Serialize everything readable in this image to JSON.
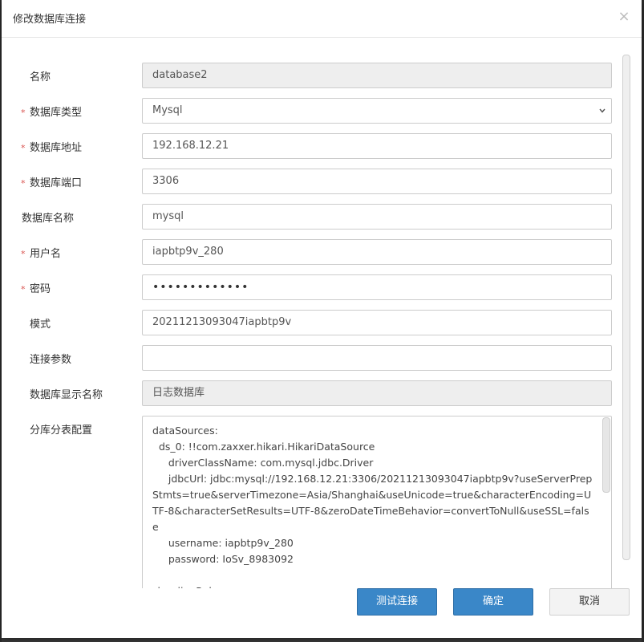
{
  "dialog": {
    "title": "修改数据库连接",
    "close_symbol": "×"
  },
  "form": {
    "name": {
      "label": "名称",
      "value": "database2",
      "required": false
    },
    "db_type": {
      "label": "数据库类型",
      "value": "Mysql",
      "required": true
    },
    "db_address": {
      "label": "数据库地址",
      "value": "192.168.12.21",
      "required": true
    },
    "db_port": {
      "label": "数据库端口",
      "value": "3306",
      "required": true
    },
    "db_name": {
      "label": "数据库名称",
      "value": "mysql",
      "required": false
    },
    "username": {
      "label": "用户名",
      "value": "iapbtp9v_280",
      "required": true
    },
    "password": {
      "label": "密码",
      "value": "•••••••••••••",
      "required": true
    },
    "schema": {
      "label": "模式",
      "value": "20211213093047iapbtp9v",
      "required": false
    },
    "conn_params": {
      "label": "连接参数",
      "value": "",
      "required": false
    },
    "display_name": {
      "label": "数据库显示名称",
      "value": "日志数据库",
      "required": false
    },
    "sharding_config": {
      "label": "分库分表配置",
      "value": "dataSources:\n  ds_0: !!com.zaxxer.hikari.HikariDataSource\n     driverClassName: com.mysql.jdbc.Driver\n     jdbcUrl: jdbc:mysql://192.168.12.21:3306/20211213093047iapbtp9v?useServerPrepStmts=true&serverTimezone=Asia/Shanghai&useUnicode=true&characterEncoding=UTF-8&characterSetResults=UTF-8&zeroDateTimeBehavior=convertToNull&useSSL=false\n     username: iapbtp9v_280\n     password: IoSv_8983092\n\nshardingRule:"
    }
  },
  "required_marker": "*",
  "buttons": {
    "test": "测试连接",
    "confirm": "确定",
    "cancel": "取消"
  },
  "colors": {
    "primary": "#3a87c8",
    "required": "#d9534f",
    "readonly_bg": "#eeeeee"
  }
}
